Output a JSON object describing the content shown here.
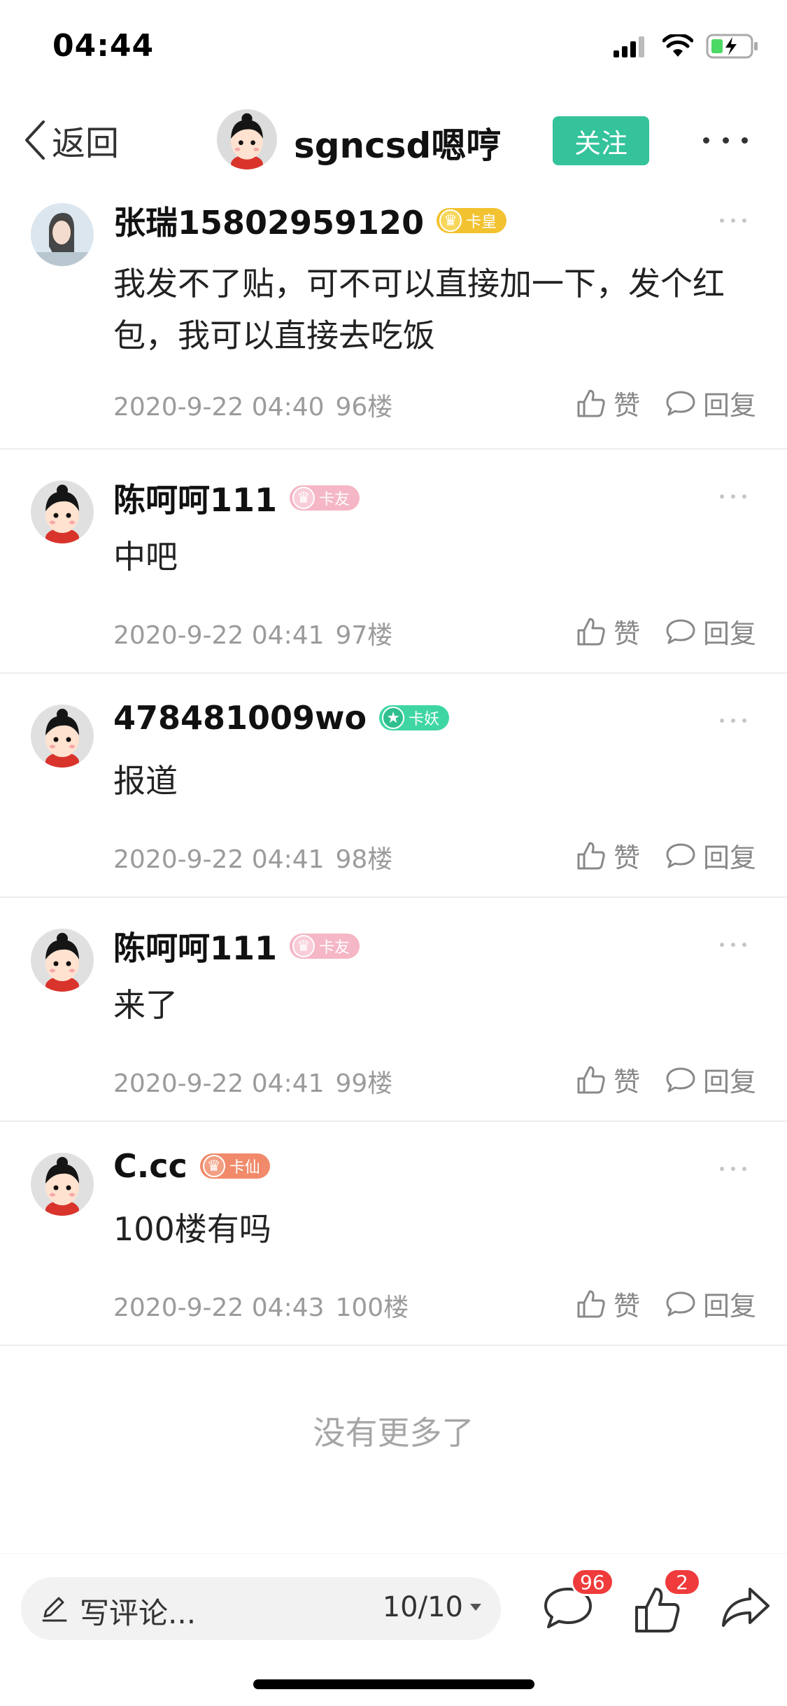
{
  "status_bar": {
    "time": "04:44"
  },
  "nav": {
    "back_label": "返回",
    "username": "sgncsd嗯哼",
    "follow_label": "关注"
  },
  "comments": [
    {
      "name": "张瑞15802959120",
      "badge": "卡皇",
      "badge_color": "#f2c230",
      "text": "我发不了贴，可不可以直接加一下，发个红包，我可以直接去吃饭",
      "time": "2020-9-22 04:40",
      "floor": "96楼",
      "like_label": "赞",
      "reply_label": "回复"
    },
    {
      "name": "陈呵呵111",
      "badge": "卡友",
      "badge_color": "#f5b6c5",
      "text": "中吧",
      "time": "2020-9-22 04:41",
      "floor": "97楼",
      "like_label": "赞",
      "reply_label": "回复"
    },
    {
      "name": "478481009wo",
      "badge": "卡妖",
      "badge_color": "#3fd6a4",
      "text": "报道",
      "time": "2020-9-22 04:41",
      "floor": "98楼",
      "like_label": "赞",
      "reply_label": "回复"
    },
    {
      "name": "陈呵呵111",
      "badge": "卡友",
      "badge_color": "#f5b6c5",
      "text": "来了",
      "time": "2020-9-22 04:41",
      "floor": "99楼",
      "like_label": "赞",
      "reply_label": "回复"
    },
    {
      "name": "C.cc",
      "badge": "卡仙",
      "badge_color": "#f08a6a",
      "text": "100楼有吗",
      "time": "2020-9-22 04:43",
      "floor": "100楼",
      "like_label": "赞",
      "reply_label": "回复"
    }
  ],
  "no_more_text": "没有更多了",
  "bottom_bar": {
    "comment_placeholder": "写评论...",
    "page_indicator": "10/10",
    "comment_count": "96",
    "like_count": "2"
  },
  "colors": {
    "accent": "#34c39b",
    "badge_red": "#ef3b3b"
  }
}
